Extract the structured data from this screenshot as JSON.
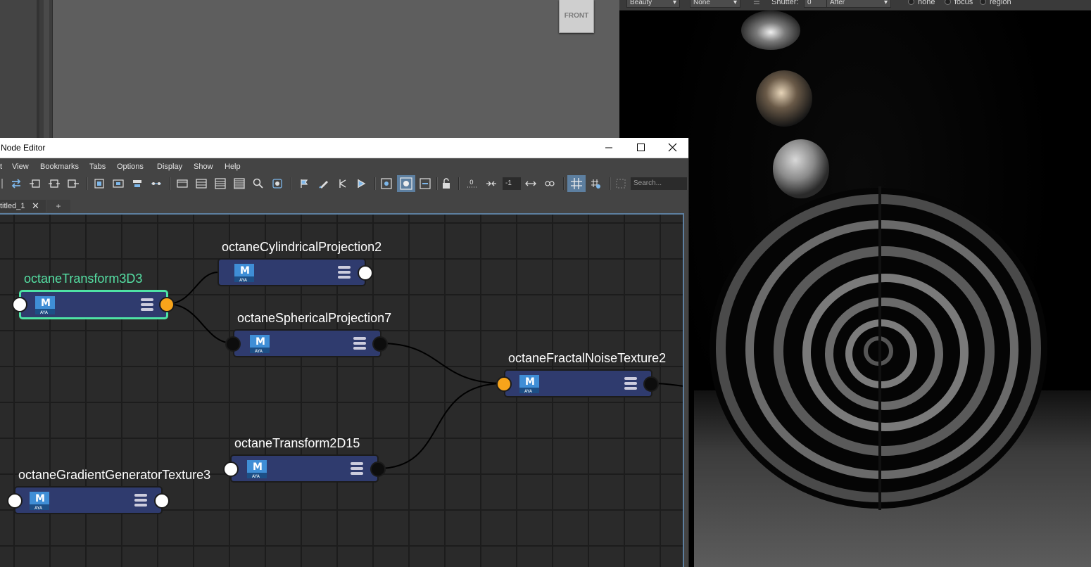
{
  "viewport": {
    "viewcube_label": "FRONT"
  },
  "render_view": {
    "toolbar": {
      "beauty": "Beauty",
      "none": "None",
      "shutter_label": "Shutter:",
      "shutter_value": "0",
      "after": "After",
      "opt_none": "none",
      "opt_focus": "focus",
      "opt_region": "region"
    }
  },
  "node_editor": {
    "title": "Node Editor",
    "window_buttons": [
      "minimize",
      "maximize",
      "close"
    ],
    "menu": [
      "View",
      "Bookmarks",
      "Tabs",
      "Options",
      "Display",
      "Show",
      "Help"
    ],
    "toolbar": {
      "field_value": "-1",
      "search_placeholder": "Search..."
    },
    "tabs": [
      {
        "label": "titled_1",
        "close": "✕"
      }
    ],
    "add_tab": "+",
    "nodes": [
      {
        "name": "octaneCylindricalProjection2"
      },
      {
        "name": "octaneTransform3D3"
      },
      {
        "name": "octaneSphericalProjection7"
      },
      {
        "name": "octaneFractalNoiseTexture2"
      },
      {
        "name": "octaneTransform2D15"
      },
      {
        "name": "octaneGradientGeneratorTexture3"
      }
    ],
    "node_icon_text": {
      "letter": "M",
      "sub": "AYA"
    },
    "colors": {
      "node_fill": "#2f3b6e",
      "selected_outline": "#4ee3a5",
      "port_orange": "#f7a41b",
      "tab_highlight": "#5d7fa0"
    }
  }
}
